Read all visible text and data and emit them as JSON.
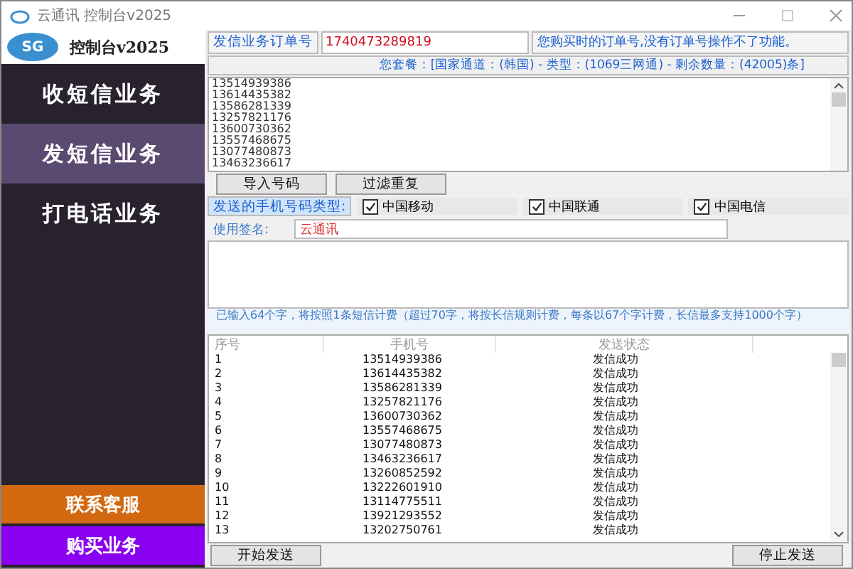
{
  "window": {
    "title": "云通讯 控制台v2025"
  },
  "sidebar": {
    "logo_text": "SG",
    "title": "控制台v2025",
    "items": [
      {
        "label": "收短信业务",
        "selected": false
      },
      {
        "label": "发短信业务",
        "selected": true
      },
      {
        "label": "打电话业务",
        "selected": false
      }
    ],
    "bottom_items": [
      {
        "label": "联系客服",
        "color": "#d2680f"
      },
      {
        "label": "购买业务",
        "color": "#8a00f0"
      }
    ]
  },
  "order": {
    "label": "发信业务订单号",
    "value": "1740473289819",
    "hint": "您购买时的订单号,没有订单号操作不了功能。"
  },
  "package_info": "您套餐：[国家通道：(韩国) - 类型：(1069三网通) - 剩余数量：(42005)条]",
  "numbers": [
    "13514939386",
    "13614435382",
    "13586281339",
    "13257821176",
    "13600730362",
    "13557468675",
    "13077480873",
    "13463236617"
  ],
  "number_buttons": [
    "导入号码",
    "过滤重复"
  ],
  "carrier_filter": {
    "label": "发送的手机号码类型:",
    "options": [
      {
        "label": "中国移动",
        "checked": true
      },
      {
        "label": "中国联通",
        "checked": true
      },
      {
        "label": "中国电信",
        "checked": true
      }
    ]
  },
  "signature": {
    "label": "使用签名:",
    "value": "云通讯"
  },
  "char_info": "已输入64个字，将按照1条短信计费（超过70字，将按长信规则计费，每条以67个字计费，长信最多支持1000个字）",
  "table": {
    "columns": [
      "序号",
      "手机号",
      "发送状态"
    ],
    "rows": [
      [
        "1",
        "13514939386",
        "发信成功"
      ],
      [
        "2",
        "13614435382",
        "发信成功"
      ],
      [
        "3",
        "13586281339",
        "发信成功"
      ],
      [
        "4",
        "13257821176",
        "发信成功"
      ],
      [
        "5",
        "13600730362",
        "发信成功"
      ],
      [
        "6",
        "13557468675",
        "发信成功"
      ],
      [
        "7",
        "13077480873",
        "发信成功"
      ],
      [
        "8",
        "13463236617",
        "发信成功"
      ],
      [
        "9",
        "13260852592",
        "发信成功"
      ],
      [
        "10",
        "13222601910",
        "发信成功"
      ],
      [
        "11",
        "13114775511",
        "发信成功"
      ],
      [
        "12",
        "13921293552",
        "发信成功"
      ],
      [
        "13",
        "13202750761",
        "发信成功"
      ]
    ]
  },
  "actions": [
    "开始发送",
    "停止发送"
  ]
}
